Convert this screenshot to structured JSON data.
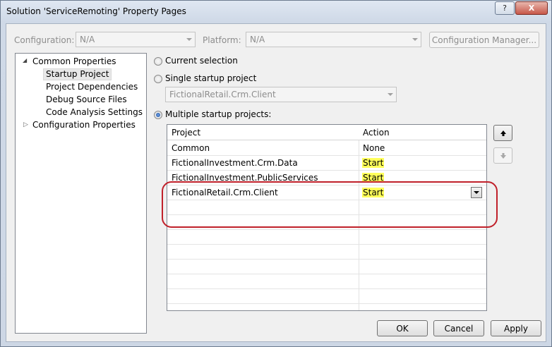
{
  "window": {
    "title": "Solution 'ServiceRemoting' Property Pages",
    "help_label": "?",
    "close_label": "X"
  },
  "top_bar": {
    "configuration_label": "Configuration:",
    "configuration_value": "N/A",
    "platform_label": "Platform:",
    "platform_value": "N/A",
    "config_manager_label": "Configuration Manager..."
  },
  "tree": {
    "items": [
      {
        "label": "Common Properties",
        "expanded": true
      },
      {
        "label": "Startup Project",
        "selected": true
      },
      {
        "label": "Project Dependencies"
      },
      {
        "label": "Debug Source Files"
      },
      {
        "label": "Code Analysis Settings"
      },
      {
        "label": "Configuration Properties",
        "expanded": false
      }
    ]
  },
  "options": {
    "current_selection": "Current selection",
    "single_startup": "Single startup project",
    "single_startup_value": "FictionalRetail.Crm.Client",
    "multiple_startup": "Multiple startup projects:",
    "selected": "multiple"
  },
  "grid": {
    "columns": [
      "Project",
      "Action"
    ],
    "rows": [
      {
        "project": "Common",
        "action": "None"
      },
      {
        "project": "FictionalInvestment.Crm.Data",
        "action": "Start"
      },
      {
        "project": "FictionalInvestment.PublicServices",
        "action": "Start"
      },
      {
        "project": "FictionalRetail.Crm.Client",
        "action": "Start"
      }
    ]
  },
  "side_buttons": {
    "up_icon": "arrow-up-icon",
    "down_icon": "arrow-down-icon"
  },
  "footer": {
    "ok_label": "OK",
    "cancel_label": "Cancel",
    "apply_label": "Apply"
  },
  "colors": {
    "highlight": "#ffff5a",
    "annotation": "#c0202a"
  }
}
